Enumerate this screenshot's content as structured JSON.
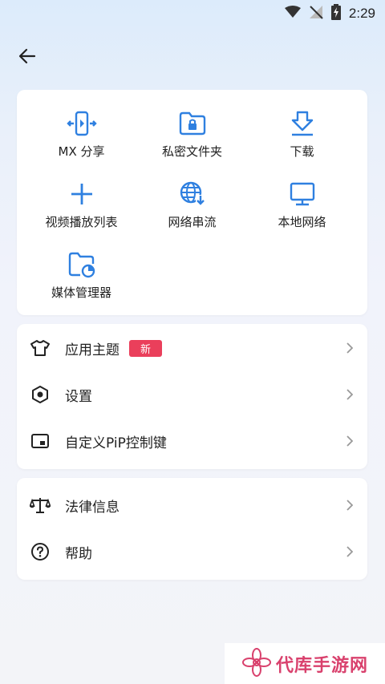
{
  "status": {
    "time": "2:29"
  },
  "grid": [
    {
      "label": "MX 分享",
      "icon": "mx-share-icon"
    },
    {
      "label": "私密文件夹",
      "icon": "private-folder-icon"
    },
    {
      "label": "下载",
      "icon": "download-icon"
    },
    {
      "label": "视频播放列表",
      "icon": "plus-icon"
    },
    {
      "label": "网络串流",
      "icon": "network-stream-icon"
    },
    {
      "label": "本地网络",
      "icon": "local-network-icon"
    },
    {
      "label": "媒体管理器",
      "icon": "media-manager-icon"
    }
  ],
  "menu1": [
    {
      "label": "应用主题",
      "badge": "新",
      "icon": "tshirt-icon"
    },
    {
      "label": "设置",
      "icon": "settings-icon"
    },
    {
      "label": "自定义PiP控制键",
      "icon": "pip-icon"
    }
  ],
  "menu2": [
    {
      "label": "法律信息",
      "icon": "scale-icon"
    },
    {
      "label": "帮助",
      "icon": "help-icon"
    }
  ],
  "watermark": {
    "text": "代库手游网"
  },
  "colors": {
    "accent": "#2f80e0",
    "badge": "#ea3f5b",
    "watermark": "#d9416d"
  }
}
